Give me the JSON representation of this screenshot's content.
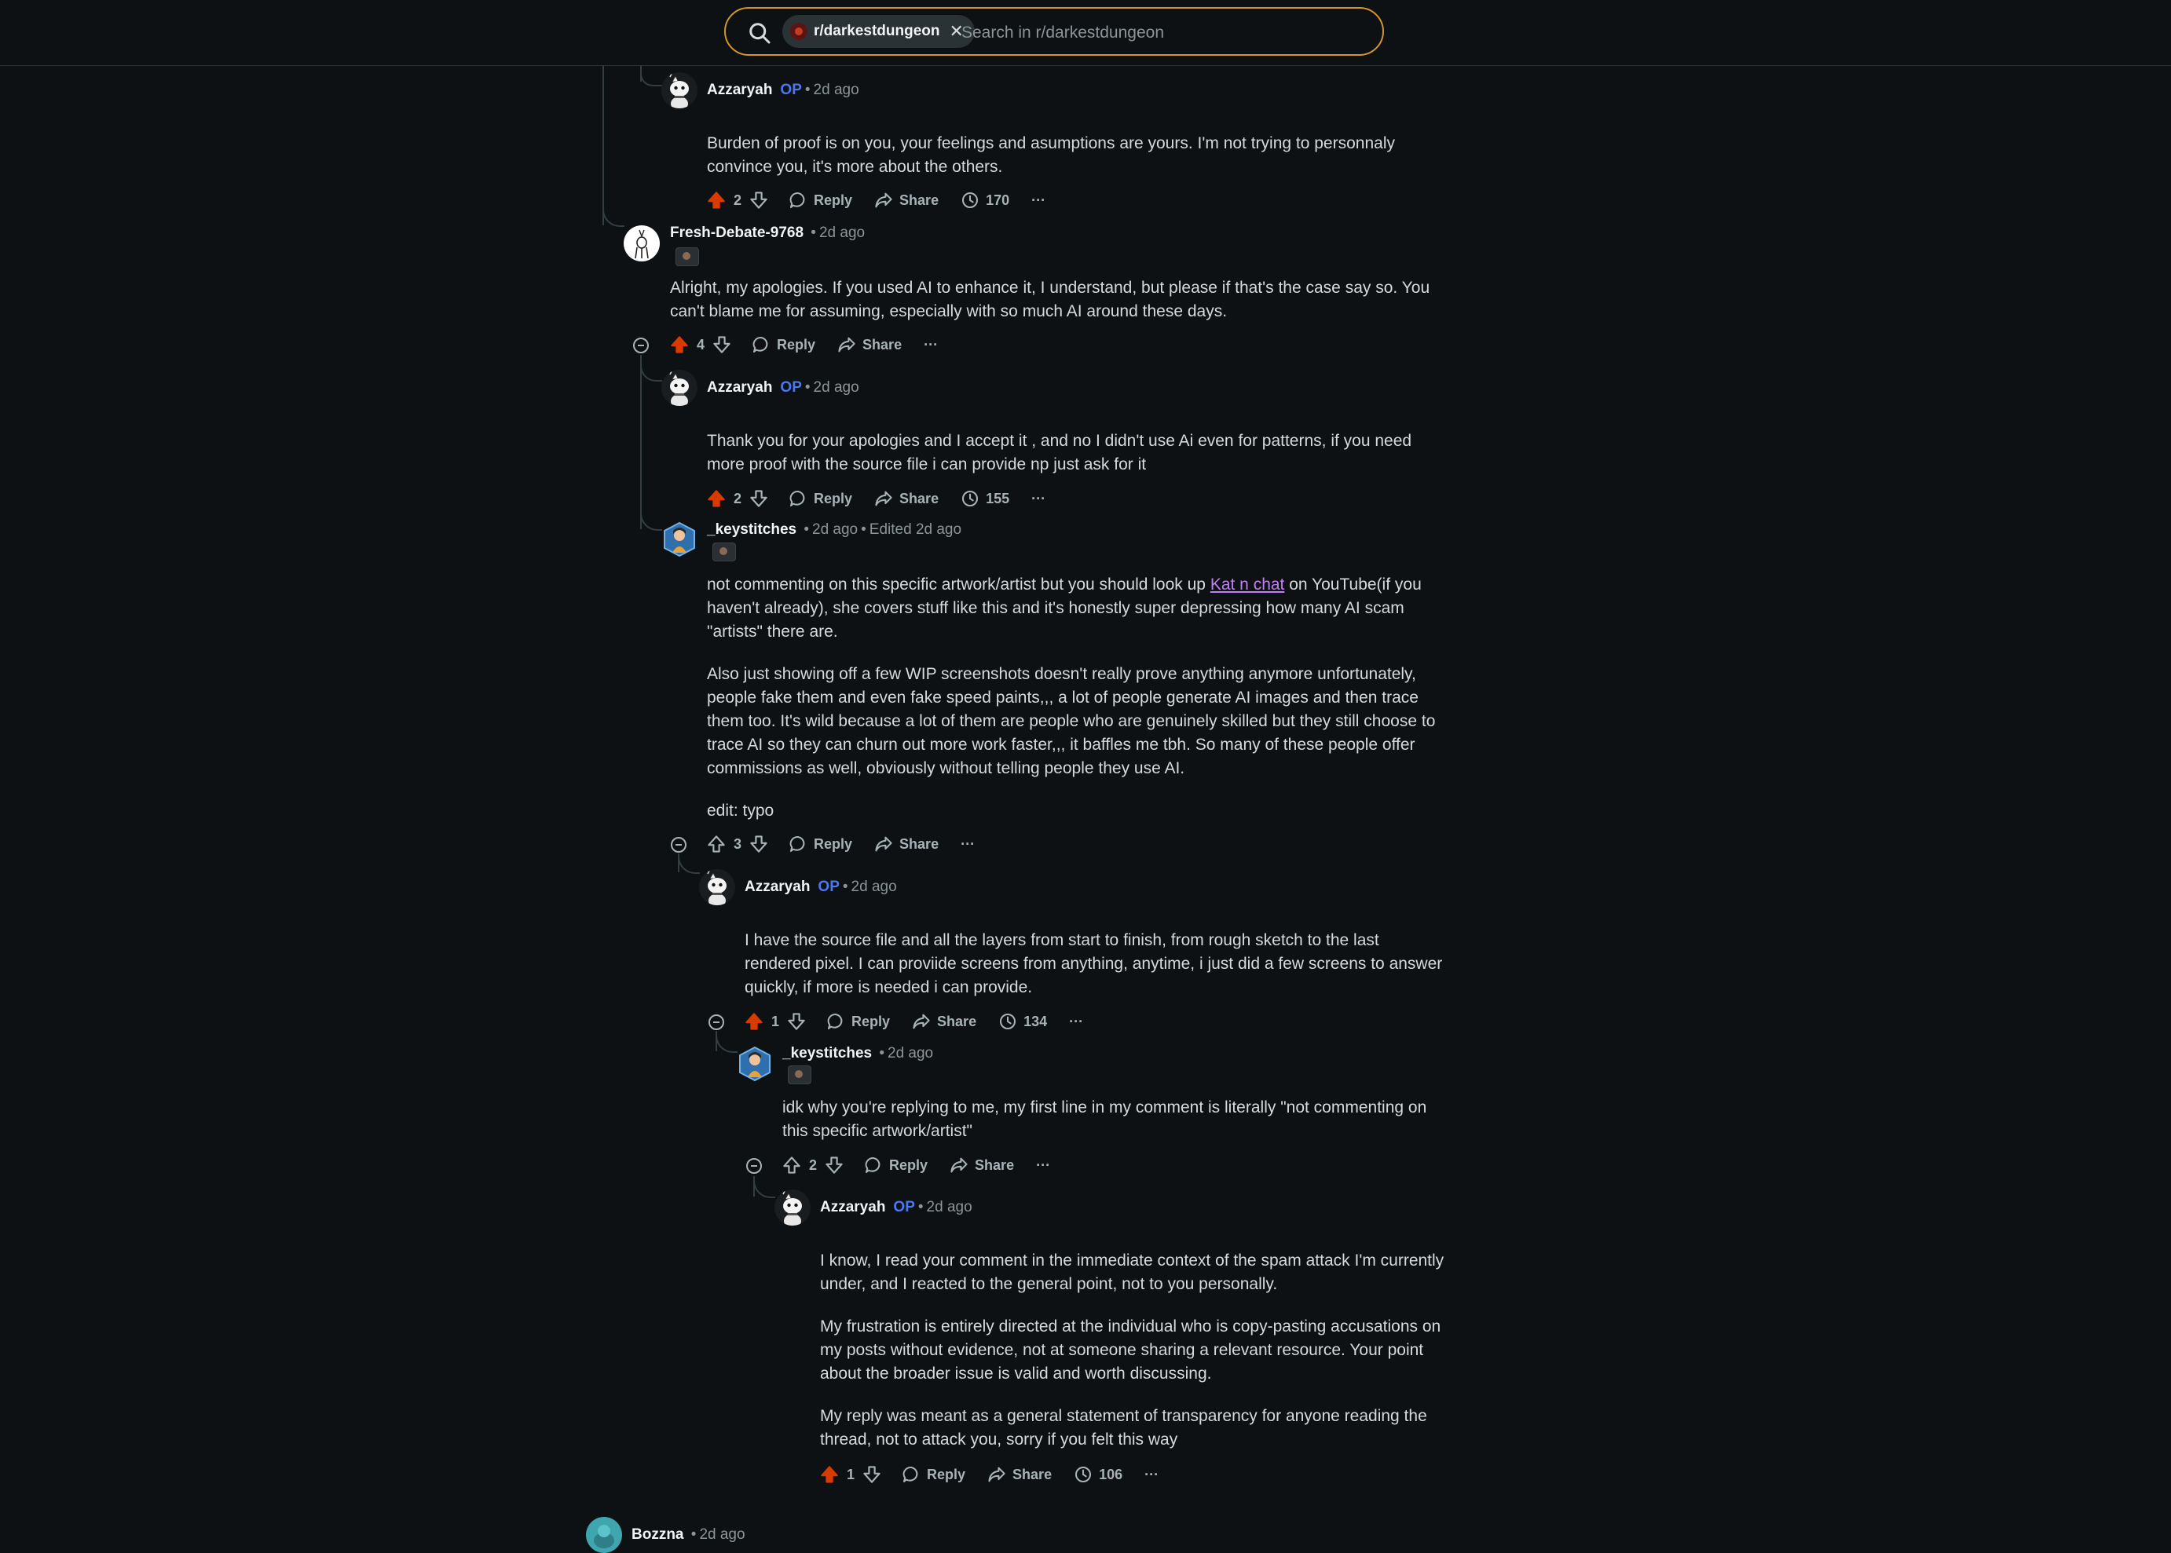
{
  "search": {
    "subreddit_chip": "r/darkestdungeon",
    "placeholder": "Search in r/darkestdungeon"
  },
  "labels": {
    "reply": "Reply",
    "share": "Share",
    "more": "···",
    "op": "OP"
  },
  "colors": {
    "accent_upvote": "#d93a00",
    "op_badge": "#4a78f0",
    "link": "#c27ef5",
    "search_border": "#d4952b"
  },
  "comments": [
    {
      "author": "Azzaryah",
      "op": true,
      "time": "2d ago",
      "paragraphs": [
        "Burden of proof is on you, your feelings and asumptions are yours. I'm not trying to personnaly convince you, it's more about the others."
      ],
      "score": "2",
      "upvoted": true,
      "views": "170"
    },
    {
      "author": "Fresh-Debate-9768",
      "op": false,
      "time": "2d ago",
      "paragraphs": [
        "Alright, my apologies. If you used AI to enhance it, I understand, but please if that's the case say so. You can't blame me for assuming, especially with so much AI around these days."
      ],
      "score": "4",
      "upvoted": true
    },
    {
      "author": "Azzaryah",
      "op": true,
      "time": "2d ago",
      "paragraphs": [
        "Thank you for your apologies and I accept it , and no I didn't use Ai even for patterns, if you need more proof with the source file i can provide np just ask for it"
      ],
      "score": "2",
      "upvoted": true,
      "views": "155"
    },
    {
      "author": "_keystitches",
      "op": false,
      "time": "2d ago",
      "edited": "Edited 2d ago",
      "p1_before": "not commenting on this specific artwork/artist but you should look up ",
      "p1_link": "Kat n chat",
      "p1_after": " on YouTube(if you haven't already), she covers stuff like this and it's honestly super depressing how many AI scam \"artists\" there are.",
      "p2": "Also just showing off a few WIP screenshots doesn't really prove anything anymore unfortunately, people fake them and even fake speed paints,,, a lot of people generate AI images and then trace them too. It's wild because a lot of them are people who are genuinely skilled but they still choose to trace AI so they can churn out more work faster,,, it baffles me tbh. So many of these people offer commissions as well, obviously without telling people they use AI.",
      "p3": "edit: typo",
      "score": "3",
      "upvoted": false
    },
    {
      "author": "Azzaryah",
      "op": true,
      "time": "2d ago",
      "paragraphs": [
        "I have the source file and all the layers from start to finish, from rough sketch to the last rendered pixel. I can proviide screens from anything, anytime, i just did a few screens to answer quickly, if more is needed i can provide."
      ],
      "score": "1",
      "upvoted": true,
      "views": "134"
    },
    {
      "author": "_keystitches",
      "op": false,
      "time": "2d ago",
      "paragraphs": [
        "idk why you're replying to me, my first line in my comment is literally \"not commenting on this specific artwork/artist\""
      ],
      "score": "2",
      "upvoted": false
    },
    {
      "author": "Azzaryah",
      "op": true,
      "time": "2d ago",
      "paragraphs": [
        " I know, I read your comment in the immediate context of the spam attack I'm currently under, and I reacted to the general point, not to you personally.",
        "My frustration is entirely directed at the individual who is copy-pasting accusations on my posts without evidence, not at someone sharing a relevant resource. Your point about the broader issue is valid and worth discussing.",
        "My reply was meant as a general statement of transparency for anyone reading the thread, not to attack you, sorry if you felt this way"
      ],
      "score": "1",
      "upvoted": true,
      "views": "106"
    },
    {
      "author": "Bozzna",
      "op": false,
      "time": "2d ago"
    }
  ]
}
